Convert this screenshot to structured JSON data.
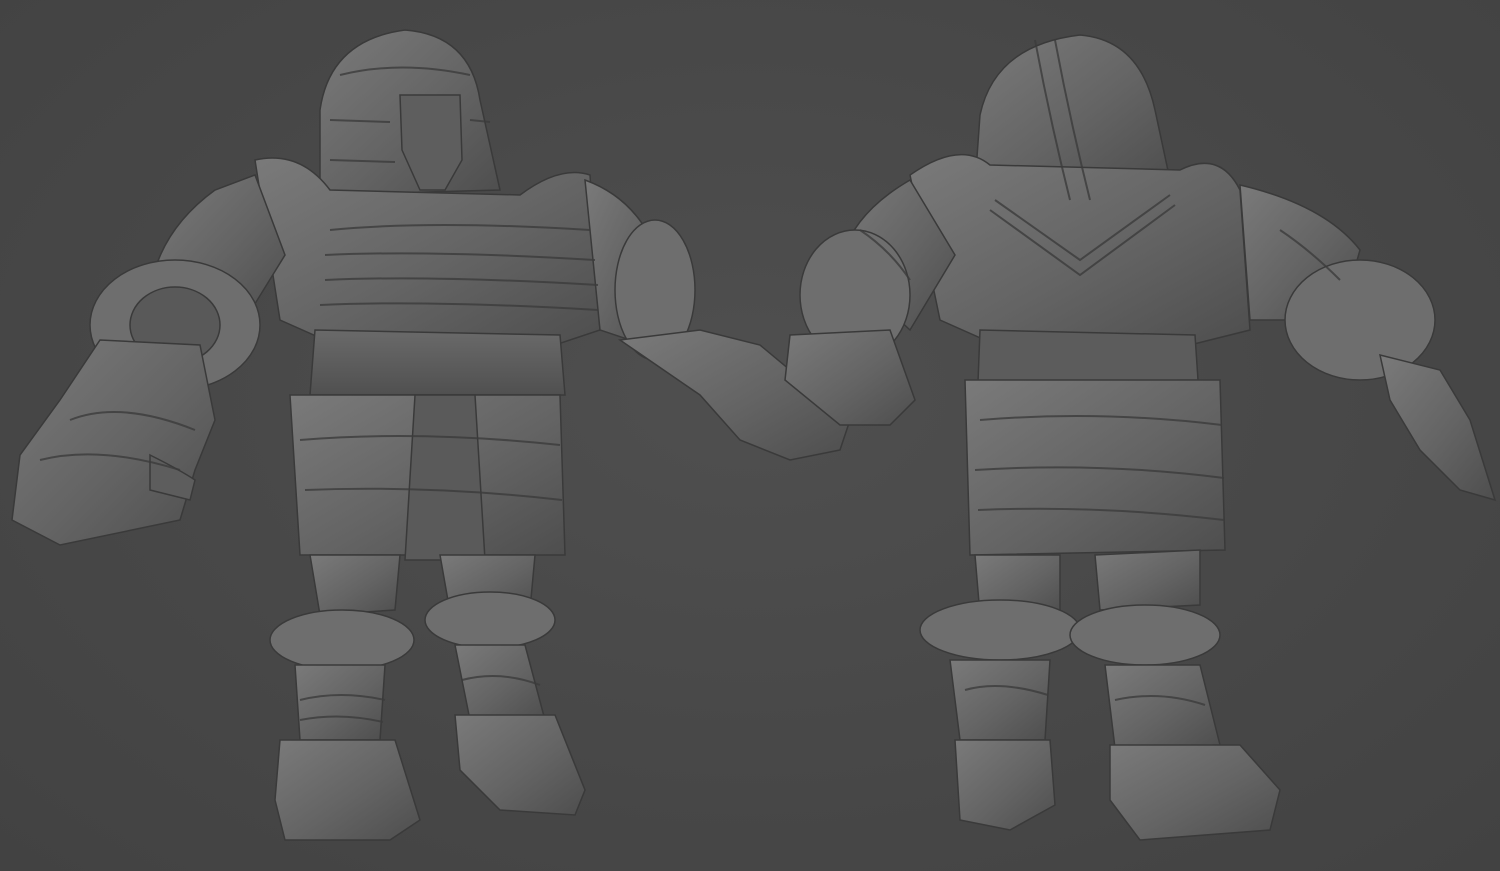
{
  "scene": {
    "background_color": "#4a4a4a",
    "material_color": "#6b6b6b",
    "views": [
      {
        "view": "front",
        "icon": "sculpt-front-view"
      },
      {
        "view": "back",
        "icon": "sculpt-back-view"
      }
    ]
  }
}
